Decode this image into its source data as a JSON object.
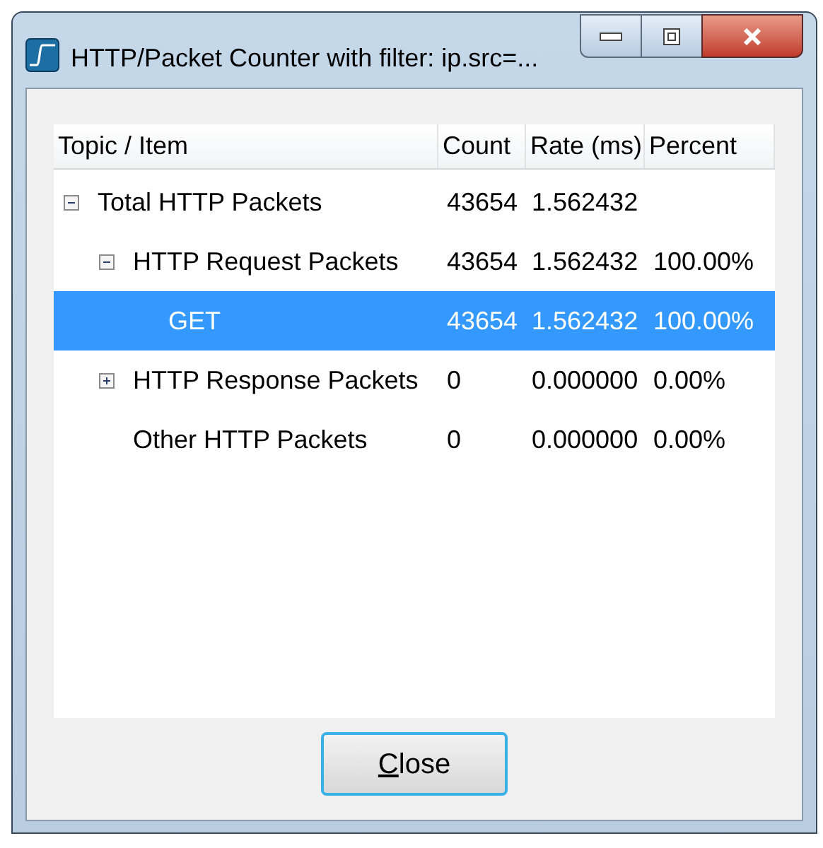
{
  "window": {
    "title": "HTTP/Packet Counter with filter: ip.src=..."
  },
  "table": {
    "columns": [
      "Topic / Item",
      "Count",
      "Rate (ms)",
      "Percent"
    ],
    "rows": [
      {
        "label": "Total HTTP Packets",
        "count": "43654",
        "rate": "1.562432",
        "selected": false,
        "expanded": true,
        "children": [
          {
            "label": "HTTP Request Packets",
            "count": "43654",
            "rate": "1.562432",
            "percent": "100.00%",
            "selected": false,
            "expanded": true,
            "children": [
              {
                "label": "GET",
                "count": "43654",
                "rate": "1.562432",
                "percent": "100.00%",
                "selected": true
              }
            ]
          },
          {
            "label": "HTTP Response Packets",
            "count": "0",
            "rate": "0.000000",
            "percent": "0.00%",
            "selected": false,
            "expanded": false
          },
          {
            "label": "Other HTTP Packets",
            "count": "0",
            "rate": "0.000000",
            "percent": "0.00%",
            "selected": false
          }
        ]
      }
    ]
  },
  "buttons": [
    {
      "label": "Close"
    }
  ]
}
